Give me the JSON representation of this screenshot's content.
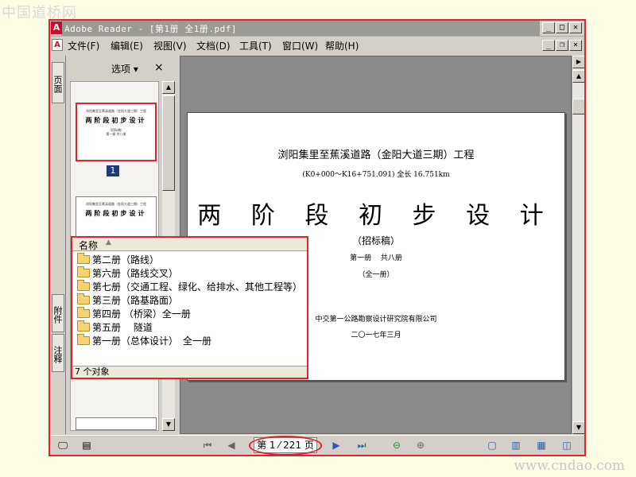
{
  "watermark": {
    "top": "中国道桥网",
    "bottom": "www.cndao.com"
  },
  "titlebar": {
    "title": "Adobe Reader - [第1册 全1册.pdf]",
    "logo": "A"
  },
  "menubar": {
    "items": [
      "文件(F)",
      "编辑(E)",
      "视图(V)",
      "文档(D)",
      "工具(T)",
      "窗口(W)",
      "帮助(H)"
    ]
  },
  "side_tabs": {
    "pages": "页面",
    "attachments": "附件",
    "comments": "注释"
  },
  "thumb_panel": {
    "options_label": "选项 ▾",
    "close": "×",
    "selected_page_number": "1"
  },
  "thumbnail": {
    "line1": "浏阳集里至蕉溪道路（金阳大道三期）工程",
    "title": "两阶段初步设计",
    "line2": "（招标稿）",
    "line3": "第一册 共八册"
  },
  "page": {
    "line1": "浏阳集里至蕉溪道路（金阳大道三期）工程",
    "line2": "(K0+000～K16+751.091) 全长 16.751km",
    "title": "两 阶 段 初 步 设 计",
    "line3": "（招标稿）",
    "line4": "第一册　 共八册",
    "line5": "（全一册）",
    "line6": "中交第一公路勘察设计研究院有限公司",
    "line7": "二〇一七年三月"
  },
  "statusbar": {
    "page_indicator": "第 1 ⁄ 221 页"
  },
  "folder_window": {
    "header": "名称",
    "items": [
      "第二册（路线）",
      "第六册（路线交叉）",
      "第七册（交通工程、绿化、给排水、其他工程等）",
      "第三册（路基路面）",
      "第四册 （桥梁）全一册",
      "第五册　 隧道",
      "第一册（总体设计）　全一册"
    ],
    "status": "7 个对象"
  },
  "colors": {
    "highlight_red": "#e0222a",
    "window_gray": "#d4d0c8",
    "doc_bg": "#8a8a8a",
    "folder": "#f5d372"
  }
}
